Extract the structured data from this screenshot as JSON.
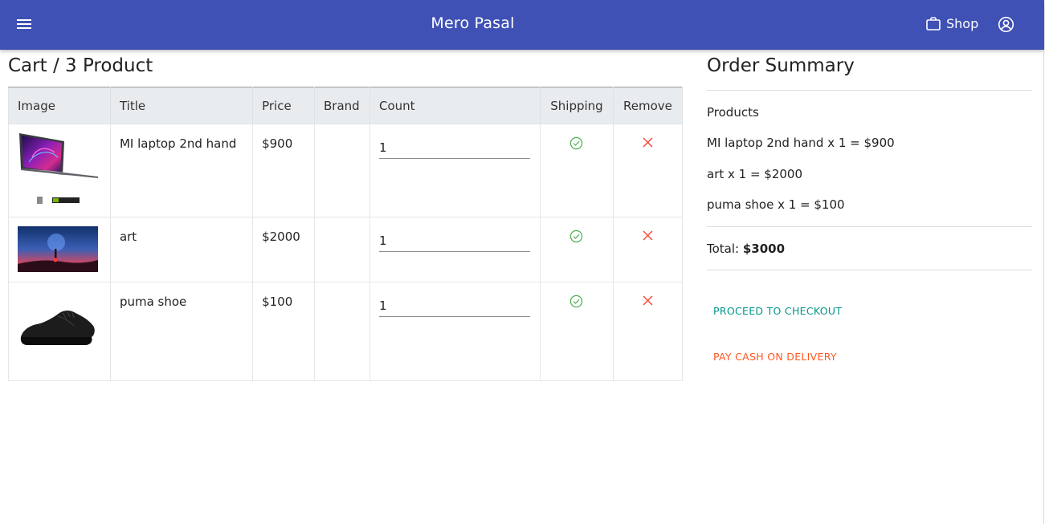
{
  "header": {
    "title": "Mero Pasal",
    "shop_label": "Shop",
    "color": "#3f51b5"
  },
  "cart": {
    "heading": "Cart / 3 Product",
    "columns": [
      "Image",
      "Title",
      "Price",
      "Brand",
      "Count",
      "Shipping",
      "Remove"
    ],
    "items": [
      {
        "title": "MI laptop 2nd hand",
        "price": "$900",
        "brand": "",
        "count": "1",
        "shipping_icon": "check-circle-icon",
        "remove_icon": "close-icon",
        "image": "laptop-image"
      },
      {
        "title": "art",
        "price": "$2000",
        "brand": "",
        "count": "1",
        "shipping_icon": "check-circle-icon",
        "remove_icon": "close-icon",
        "image": "art-image"
      },
      {
        "title": "puma shoe",
        "price": "$100",
        "brand": "",
        "count": "1",
        "shipping_icon": "check-circle-icon",
        "remove_icon": "close-icon",
        "image": "shoe-image"
      }
    ]
  },
  "summary": {
    "heading": "Order Summary",
    "products_label": "Products",
    "lines": [
      "MI laptop 2nd hand x 1 = $900",
      "art x 1 = $2000",
      "puma shoe x 1 = $100"
    ],
    "total_label": "Total:",
    "total_value": "$3000",
    "checkout_label": "PROCEED TO CHECKOUT",
    "cod_label": "PAY CASH ON DELIVERY",
    "checkout_color": "#009688",
    "cod_color": "#ff5722"
  },
  "colors": {
    "ok": "#4caf50",
    "remove": "#f44336"
  }
}
